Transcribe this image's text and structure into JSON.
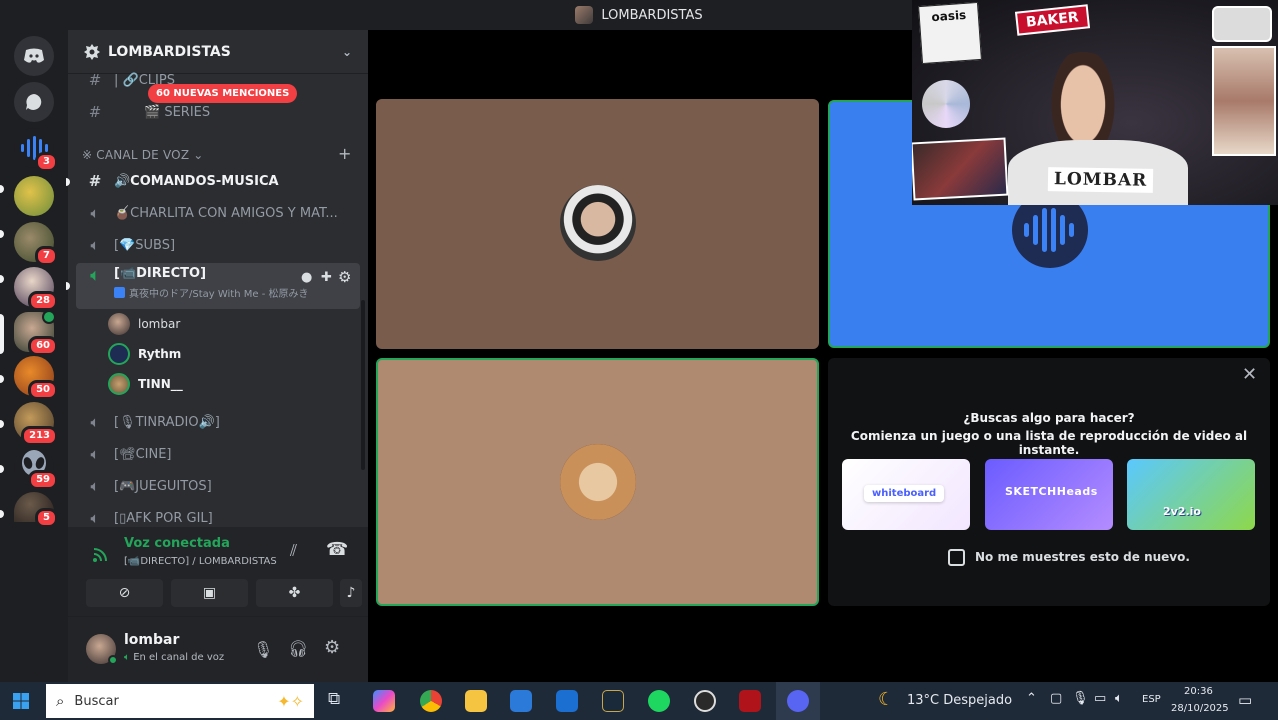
{
  "window": {
    "title": "LOMBARDISTAS"
  },
  "rail": {
    "servers": [
      {
        "name": "discord-home",
        "badge": ""
      },
      {
        "name": "direct-messages",
        "badge": ""
      },
      {
        "name": "rythm",
        "badge": "3"
      },
      {
        "name": "server-1",
        "badge": ""
      },
      {
        "name": "server-2",
        "badge": "7"
      },
      {
        "name": "server-3",
        "badge": "28"
      },
      {
        "name": "lombardistas",
        "badge": "60"
      },
      {
        "name": "server-5",
        "badge": "50"
      },
      {
        "name": "server-6",
        "badge": "213"
      },
      {
        "name": "server-7",
        "badge": "59"
      },
      {
        "name": "server-8",
        "badge": "5"
      }
    ]
  },
  "sidebar": {
    "server_name": "LOMBARDISTAS",
    "mentions_pill": "60 NUEVAS MENCIONES",
    "channels_top": [
      "| 🔗CLIPS",
      "🎬 SERIES"
    ],
    "category": "※ CANAL DE VOZ",
    "channels": [
      {
        "name": "🔊COMANDOS-MUSICA",
        "type": "text"
      },
      {
        "name": "🧉CHARLITA CON AMIGOS Y MAT...",
        "type": "voice"
      },
      {
        "name": "[💎SUBS]",
        "type": "voice"
      },
      {
        "name": "[📹DIRECTO]",
        "type": "voice",
        "activity": "真夜中のドア/Stay With Me - 松原みき"
      },
      {
        "name": "[🎙TINRADIO🔊]",
        "type": "voice"
      },
      {
        "name": "[📽CINE]",
        "type": "voice"
      },
      {
        "name": "[🎮JUEGUITOS]",
        "type": "voice"
      },
      {
        "name": "[▯AFK POR GIL]",
        "type": "voice"
      }
    ],
    "members": [
      "lombar",
      "Rythm",
      "TINN__"
    ]
  },
  "voice": {
    "status": "Voz conectada",
    "location": "[📹DIRECTO] / LOMBARDISTAS"
  },
  "user": {
    "name": "lombar",
    "status": "En el canal de voz"
  },
  "activity": {
    "line1": "¿Buscas algo para hacer?",
    "line2": "Comienza un juego o una lista de reproducción de video al instante.",
    "apps": [
      "whiteboard",
      "SKETCHHeads",
      "2v2.io"
    ],
    "checkbox_label": "No me muestres esto de nuevo."
  },
  "webcam": {
    "stickers": [
      "oasis",
      "BAKER",
      "LOMBAR"
    ]
  },
  "taskbar": {
    "search_placeholder": "Buscar",
    "weather": "13°C  Despejado",
    "lang": "ESP",
    "time": "20:36",
    "date": "28/10/2025"
  },
  "colors": {
    "accent_green": "#23a55a",
    "badge_red": "#f23f43",
    "blurple": "#5865f2",
    "tile_brown": "#7a5c4c",
    "tile_tan": "#b08a70",
    "tile_blue": "#3a7ff0"
  }
}
